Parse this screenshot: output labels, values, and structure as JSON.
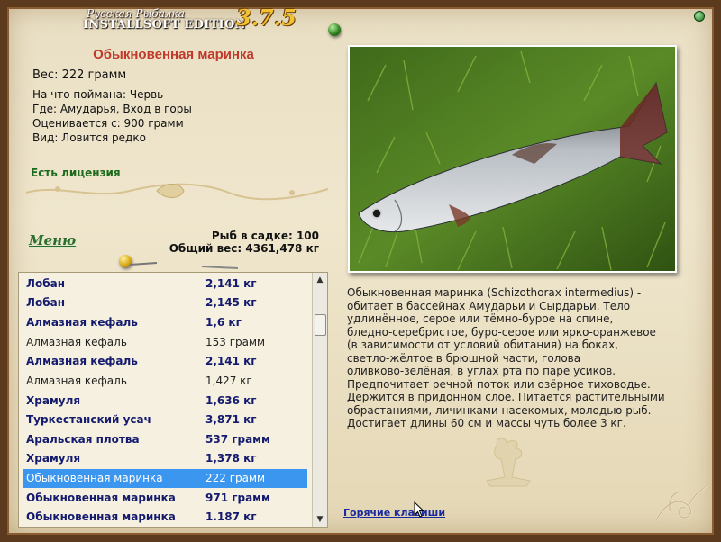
{
  "app": {
    "logo_line1": "Русская Рыбалка",
    "logo_line2": "INSTALLSOFT EDITION",
    "version": "3.7.5",
    "accent_color": "#c0392b"
  },
  "fish": {
    "name": "Обыкновенная маринка",
    "weight": "Вес: 222 грамм",
    "bait": "На что поймана: Червь",
    "location": "Где: Амударья, Вход в горы",
    "value": "Оценивается с: 900 грамм",
    "rarity": "Вид: Ловится редко",
    "license": "Есть лицензия"
  },
  "menu": {
    "label": "Меню"
  },
  "stats": {
    "count": "Рыб в садке: 100",
    "total_weight": "Общий вес: 4361,478 кг"
  },
  "catch_list": [
    {
      "name": "Лобан",
      "weight": "2,141 кг",
      "style": "bold"
    },
    {
      "name": "Лобан",
      "weight": "2,145 кг",
      "style": "bold"
    },
    {
      "name": "Алмазная кефаль",
      "weight": "1,6 кг",
      "style": "bold"
    },
    {
      "name": "Алмазная кефаль",
      "weight": "153 грамм",
      "style": "plain"
    },
    {
      "name": "Алмазная кефаль",
      "weight": "2,141 кг",
      "style": "bold"
    },
    {
      "name": "Алмазная кефаль",
      "weight": "1,427 кг",
      "style": "plain"
    },
    {
      "name": "Храмуля",
      "weight": "1,636 кг",
      "style": "bold"
    },
    {
      "name": "Туркестанский усач",
      "weight": "3,871 кг",
      "style": "bold"
    },
    {
      "name": "Аральская плотва",
      "weight": "537 грамм",
      "style": "bold"
    },
    {
      "name": "Храмуля",
      "weight": "1,378 кг",
      "style": "bold"
    },
    {
      "name": "Обыкновенная маринка",
      "weight": "222 грамм",
      "style": "sel"
    },
    {
      "name": "Обыкновенная маринка",
      "weight": "971 грамм",
      "style": "bold"
    },
    {
      "name": "Обыкновенная маринка",
      "weight": "1.187 кг",
      "style": "bold"
    }
  ],
  "description": "Обыкновенная маринка (Schizothorax intermedius) -\nобитает в бассейнах Амударьи и Сырдарьи. Тело\nудлинённое, серое или тёмно-бурое на спине,\nбледно-серебристое, буро-серое или ярко-оранжевое\n(в зависимости от условий обитания) на боках,\nсветло-жёлтое в брюшной части, голова\nоливково-зелёная, в углах рта по паре усиков.\nПредпочитает речной поток или озёрное тиховодье.\nДержится в придонном слое. Питается растительными\nобрастаниями, личинками насекомых, молодью рыб.\nДостигает длины 60 см и массы чуть более 3 кг.",
  "hotkeys": "Горячие клавиши"
}
